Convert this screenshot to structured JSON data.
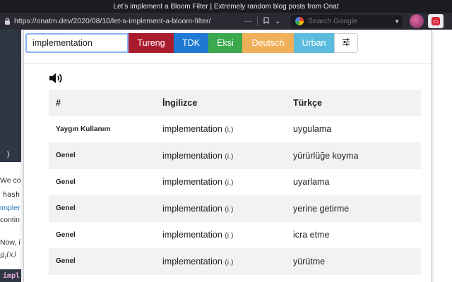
{
  "window": {
    "title": "Let’s implement a Bloom Filter | Extremely random blog posts from Onat"
  },
  "navbar": {
    "url": "https://onatm.dev/2020/08/10/let-s-implement-a-bloom-filter/",
    "icons": {
      "more": "···",
      "bookmark": "bookmark-icon",
      "dropdown": "⌄"
    }
  },
  "search": {
    "placeholder": "Search Google"
  },
  "background_page": {
    "code_brace": "}",
    "line1_start": "We co",
    "line2_code": "hash",
    "line3_link": "impler",
    "line4_start": "contin",
    "line5_start": "Now, i",
    "line6_math": "g",
    "line6_sub": "i",
    "line6_rest": "(x)",
    "code2": "impl"
  },
  "popup": {
    "term_value": "implementation",
    "tabs": {
      "tureng": "Tureng",
      "tdk": "TDK",
      "eksi": "Eksi",
      "deutsch": "Deutsch",
      "urban": "Urban"
    },
    "colors": {
      "tureng": "#a91c2e",
      "tdk": "#1f78d1",
      "eksi": "#3aa84d",
      "deutsch": "#f0b05a",
      "urban": "#5bbbdd",
      "focus": "#8ab4f8"
    },
    "table": {
      "headers": {
        "num": "#",
        "english": "İngilizce",
        "turkish": "Türkçe"
      },
      "rows": [
        {
          "category": "Yaygın Kullanım",
          "term": "implementation",
          "pos": "(i.)",
          "translation": "uygulama"
        },
        {
          "category": "Genel",
          "term": "implementation",
          "pos": "(i.)",
          "translation": "yürürlüğe koyma"
        },
        {
          "category": "Genel",
          "term": "implementation",
          "pos": "(i.)",
          "translation": "uyarlama"
        },
        {
          "category": "Genel",
          "term": "implementation",
          "pos": "(i.)",
          "translation": "yerine getirme"
        },
        {
          "category": "Genel",
          "term": "implementation",
          "pos": "(i.)",
          "translation": "icra etme"
        },
        {
          "category": "Genel",
          "term": "implementation",
          "pos": "(i.)",
          "translation": "yürütme"
        }
      ]
    }
  }
}
